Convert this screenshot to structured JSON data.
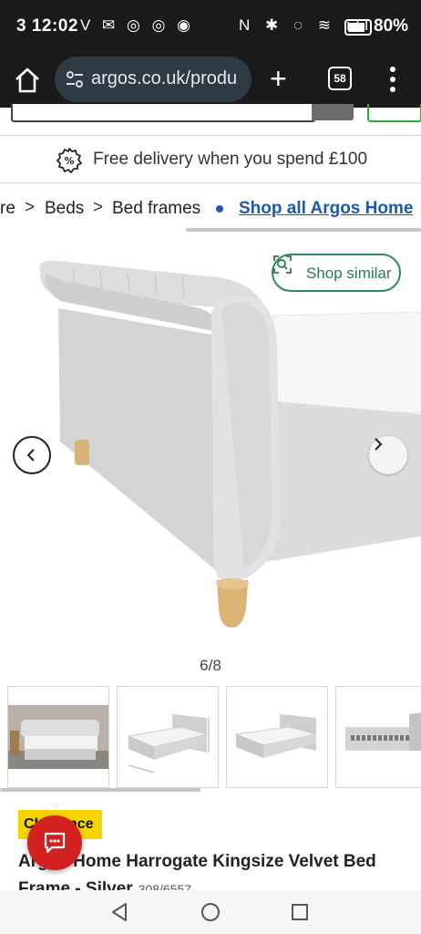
{
  "status_bar": {
    "time": "3 12:02",
    "left_icons": "V ✉ ◎ ◎ ◉",
    "right_icons": "N ✱ ◌ ≋ ıll",
    "battery_level": 0.8,
    "battery_label": "80%"
  },
  "browser": {
    "url": "argos.co.uk/produ",
    "tab_count": "58",
    "icons": [
      "home-icon",
      "tune-icon",
      "plus-icon",
      "tabs-icon",
      "more-vert-icon"
    ]
  },
  "delivery": {
    "text": "Free delivery when you spend £100",
    "icon": "discount-badge-icon"
  },
  "breadcrumb": {
    "items": [
      "re",
      "Beds",
      "Bed frames"
    ],
    "link": "Shop all Argos Home"
  },
  "gallery": {
    "shop_similar_label": "Shop similar",
    "counter": "6/8",
    "colors": {
      "accent_green": "#2e8a5c",
      "link_blue": "#1e5aa8"
    }
  },
  "product": {
    "badge": "Clearance",
    "title": "Argos Home Harrogate Kingsize Velvet Bed Frame - Silver",
    "sku": "308/6557"
  },
  "nav": {
    "icons": [
      "back-triangle-icon",
      "home-circle-icon",
      "recents-square-icon"
    ]
  }
}
